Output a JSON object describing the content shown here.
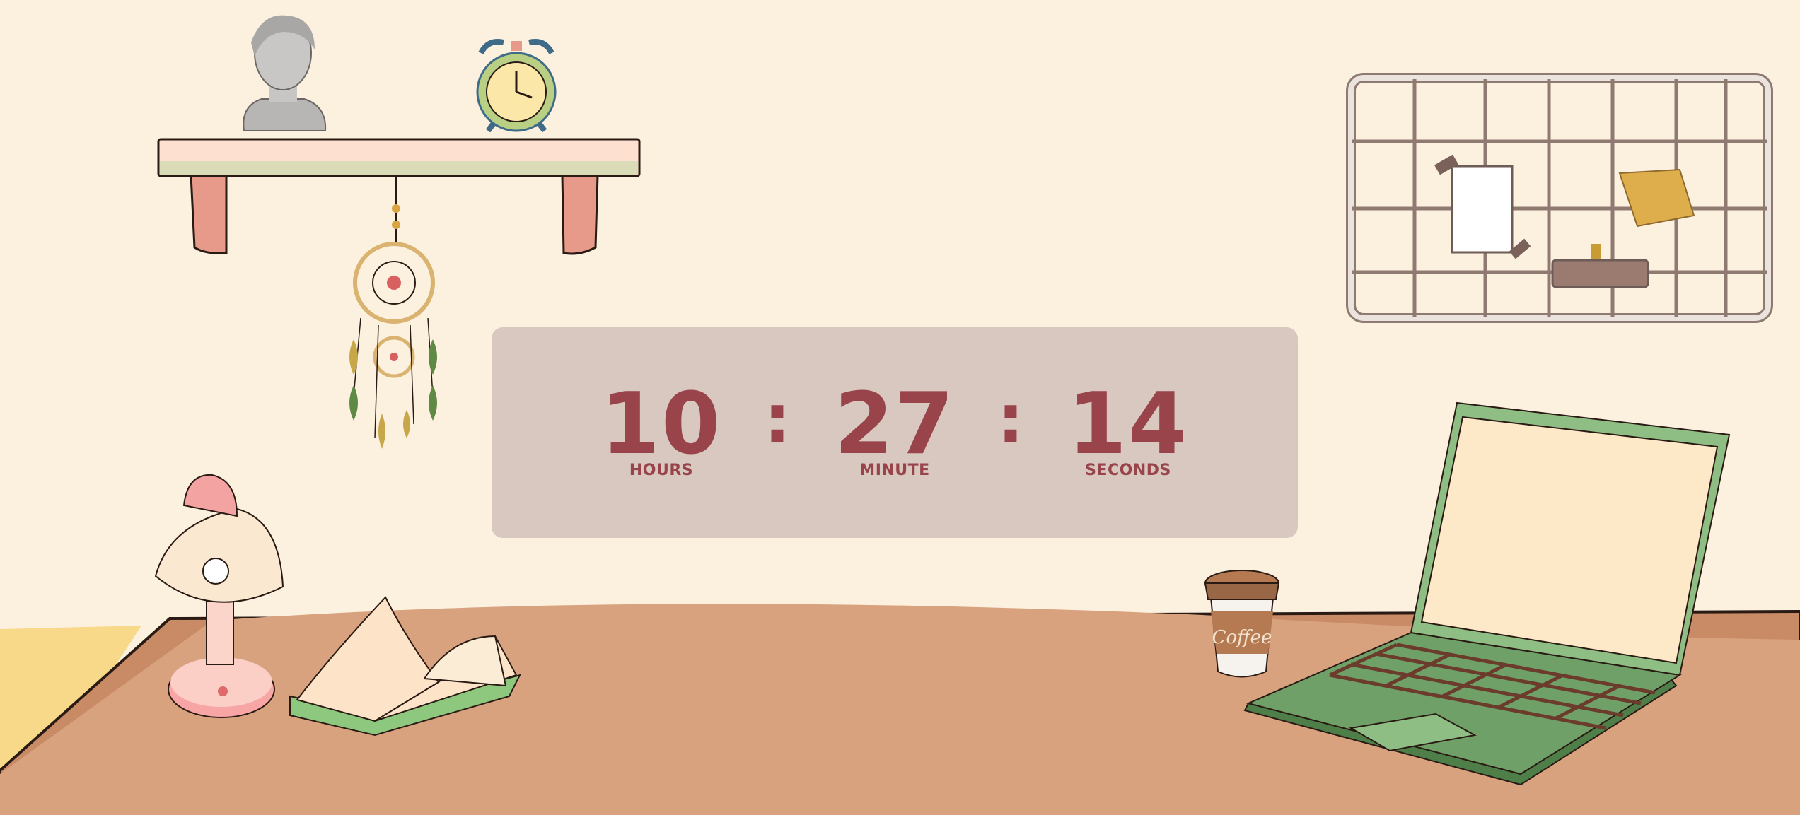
{
  "timer": {
    "hours": "10",
    "minutes": "27",
    "seconds": "14",
    "separator": ":",
    "hours_label": "HOURS",
    "minutes_label": "MINUTE",
    "seconds_label": "SECONDS"
  },
  "scene": {
    "coffee_cup_text": "Coffee",
    "items": [
      "statue-bust",
      "alarm-clock",
      "wall-shelf",
      "dream-catcher",
      "wire-memo-grid",
      "desk-lamp",
      "open-book",
      "coffee-cup",
      "laptop",
      "desk"
    ]
  },
  "colors": {
    "background": "#fcf0df",
    "panel": "#d8c8c0",
    "digits": "#98444a",
    "desk": "#d8a27f",
    "laptop": "#8fbe85"
  }
}
